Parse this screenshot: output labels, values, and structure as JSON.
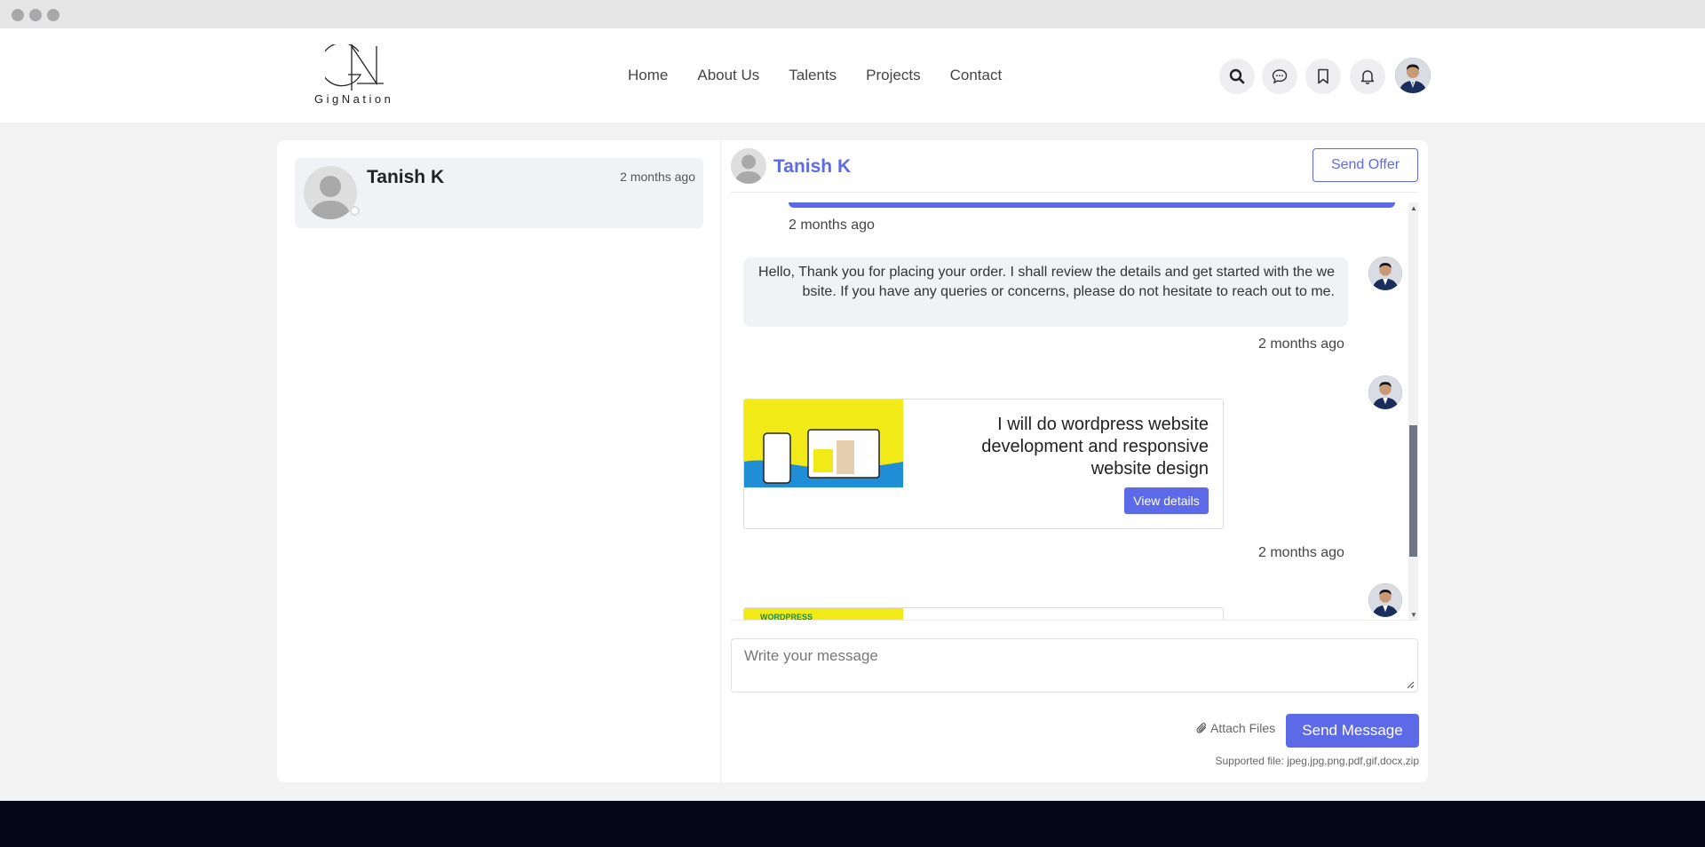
{
  "brand": {
    "name": "GigNation"
  },
  "nav": {
    "items": [
      "Home",
      "About Us",
      "Talents",
      "Projects",
      "Contact"
    ]
  },
  "header_icons": [
    "search-icon",
    "chat-icon",
    "bookmark-icon",
    "bell-icon"
  ],
  "colors": {
    "accent": "#5c6ae8",
    "footer": "#050617",
    "bubble": "#f1f2f6"
  },
  "conversations": [
    {
      "name": "Tanish K",
      "time": "2 months ago"
    }
  ],
  "chat": {
    "contact_name": "Tanish K",
    "send_offer_label": "Send Offer",
    "messages": [
      {
        "time": "2 months ago"
      },
      {
        "text": "Hello, Thank you for placing your order. I shall review the details and get started with the website. If you have any queries or concerns, please do not hesitate to reach out to me.",
        "time": "2 months ago"
      },
      {
        "card_title": "I will do wordpress website development and responsive website design",
        "card_button": "View details",
        "time": "2 months ago"
      },
      {
        "card_thumb_label": "WORDPRESS"
      }
    ],
    "composer_placeholder": "Write your message",
    "attach_label": "Attach Files",
    "send_label": "Send Message",
    "supported_files": "Supported file: jpeg,jpg,png,pdf,gif,docx,zip"
  }
}
